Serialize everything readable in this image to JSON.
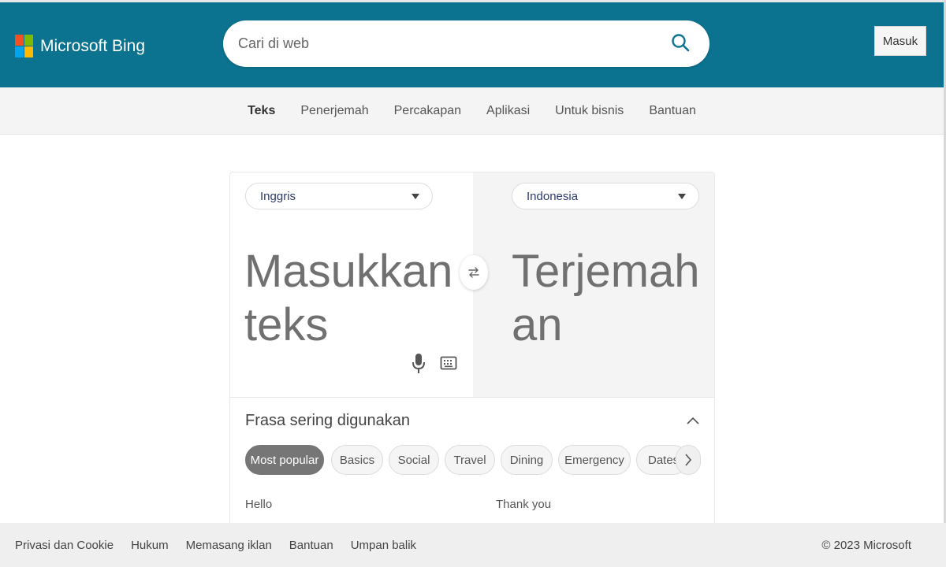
{
  "header": {
    "brand": "Microsoft Bing",
    "logo_colors": [
      "#f25022",
      "#7fba00",
      "#00a4ef",
      "#ffb900"
    ],
    "bg_color": "#0b7390",
    "search": {
      "placeholder": "Cari di web",
      "value": "",
      "icon": "search-icon"
    },
    "signin_label": "Masuk"
  },
  "nav": {
    "items": [
      {
        "label": "Teks",
        "active": true
      },
      {
        "label": "Penerjemah"
      },
      {
        "label": "Percakapan"
      },
      {
        "label": "Aplikasi"
      },
      {
        "label": "Untuk bisnis"
      },
      {
        "label": "Bantuan"
      }
    ]
  },
  "translator": {
    "source_language": "Inggris",
    "target_language": "Indonesia",
    "source_placeholder": "Masukkan teks",
    "target_placeholder": "Terjemahan",
    "icons": {
      "swap": "swap-icon",
      "mic": "microphone-icon",
      "keyboard": "keyboard-icon"
    }
  },
  "phrases": {
    "title": "Frasa sering digunakan",
    "categories": [
      "Most popular",
      "Basics",
      "Social",
      "Travel",
      "Dining",
      "Emergency",
      "Dates"
    ],
    "selected": "Most popular",
    "items": [
      "Hello",
      "Thank you"
    ]
  },
  "footer": {
    "links": [
      "Privasi dan Cookie",
      "Hukum",
      "Memasang iklan",
      "Bantuan",
      "Umpan balik"
    ],
    "copyright": "© 2023 Microsoft"
  }
}
